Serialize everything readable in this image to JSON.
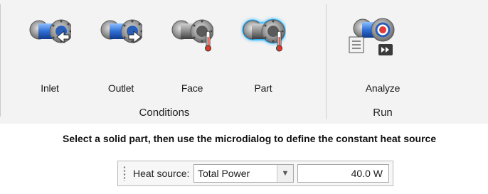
{
  "ribbon": {
    "groups": [
      {
        "label": "Conditions",
        "tools": [
          {
            "label": "Inlet",
            "icon": "inlet-icon"
          },
          {
            "label": "Outlet",
            "icon": "outlet-icon"
          },
          {
            "label": "Face",
            "icon": "face-heat-icon"
          },
          {
            "label": "Part",
            "icon": "part-heat-icon",
            "active": true
          }
        ]
      },
      {
        "label": "Run",
        "tools": [
          {
            "label": "Analyze",
            "icon": "analyze-icon"
          }
        ]
      }
    ]
  },
  "instruction": "Select a solid part, then use the microdialog to define the constant heat source",
  "microdialog": {
    "label": "Heat source:",
    "select_value": "Total Power",
    "value": "40.0 W"
  },
  "colors": {
    "ribbon_bg": "#f3f3f3",
    "pipe_blue": "#2f6fd6",
    "pipe_gray": "#8a8a8a",
    "active_glow": "#2fb6ff",
    "thermometer_red": "#d83a2b"
  }
}
